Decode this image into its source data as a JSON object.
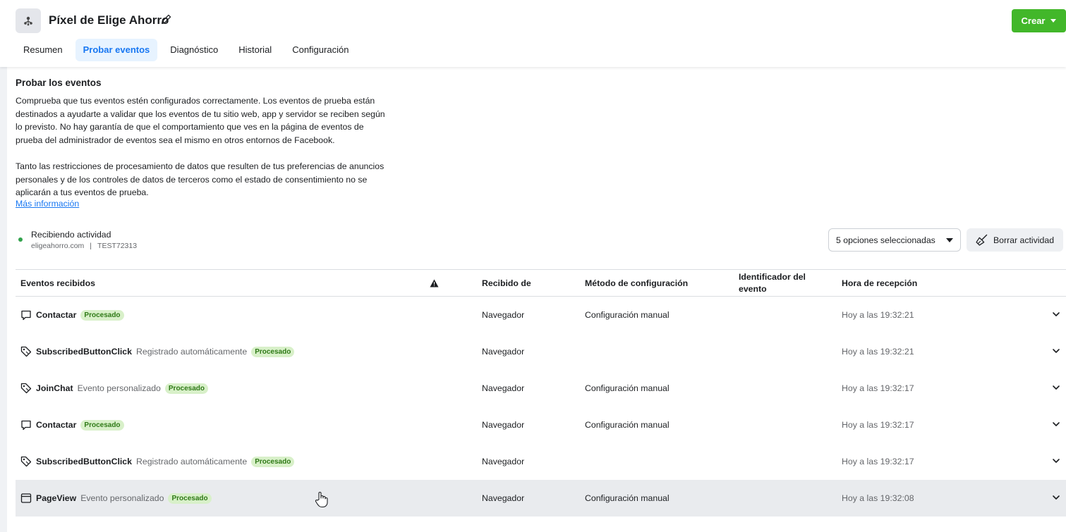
{
  "header": {
    "title": "Píxel de Elige Ahorro",
    "create_label": "Crear",
    "tabs": [
      {
        "label": "Resumen",
        "active": false
      },
      {
        "label": "Probar eventos",
        "active": true
      },
      {
        "label": "Diagnóstico",
        "active": false
      },
      {
        "label": "Historial",
        "active": false
      },
      {
        "label": "Configuración",
        "active": false
      }
    ]
  },
  "intro": {
    "title": "Probar los eventos",
    "paragraph1": "Comprueba que tus eventos estén configurados correctamente. Los eventos de prueba están destinados a ayudarte a validar que los eventos de tu sitio web, app y servidor se reciben según lo previsto. No hay garantía de que el comportamiento que ves en la página de eventos de prueba del administrador de eventos sea el mismo en otros entornos de Facebook.",
    "paragraph2": "Tanto las restricciones de procesamiento de datos que resulten de tus preferencias de anuncios personales y de los controles de datos de terceros como el estado de consentimiento no se aplicarán a tus eventos de prueba.",
    "link": "Más información"
  },
  "status": {
    "label": "Recibiendo actividad",
    "domain": "eligeahorro.com",
    "separator": "|",
    "test_code": "TEST72313",
    "dot_color": "#31a24c"
  },
  "controls": {
    "filter_label": "5 opciones seleccionadas",
    "clear_label": "Borrar actividad"
  },
  "table": {
    "headers": {
      "events": "Eventos recibidos",
      "received_from": "Recibido de",
      "method": "Método de configuración",
      "event_id_line1": "Identificador del",
      "event_id_line2": "evento",
      "time": "Hora de recepción"
    },
    "rows": [
      {
        "icon": "chat-icon",
        "name": "Contactar",
        "sub": "",
        "badge": "Procesado",
        "source": "Navegador",
        "method": "Configuración manual",
        "event_id": "",
        "time": "Hoy a las 19:32:21"
      },
      {
        "icon": "tag-icon",
        "name": "SubscribedButtonClick",
        "sub": "Registrado automáticamente",
        "badge": "Procesado",
        "source": "Navegador",
        "method": "",
        "event_id": "",
        "time": "Hoy a las 19:32:21"
      },
      {
        "icon": "tag-icon",
        "name": "JoinChat",
        "sub": "Evento personalizado",
        "badge": "Procesado",
        "source": "Navegador",
        "method": "Configuración manual",
        "event_id": "",
        "time": "Hoy a las 19:32:17"
      },
      {
        "icon": "chat-icon",
        "name": "Contactar",
        "sub": "",
        "badge": "Procesado",
        "source": "Navegador",
        "method": "Configuración manual",
        "event_id": "",
        "time": "Hoy a las 19:32:17"
      },
      {
        "icon": "tag-icon",
        "name": "SubscribedButtonClick",
        "sub": "Registrado automáticamente",
        "badge": "Procesado",
        "source": "Navegador",
        "method": "",
        "event_id": "",
        "time": "Hoy a las 19:32:17"
      },
      {
        "icon": "page-icon",
        "name": "PageView",
        "sub": "Evento personalizado",
        "badge": "Procesado",
        "source": "Navegador",
        "method": "Configuración manual",
        "event_id": "",
        "time": "Hoy a las 19:32:08"
      }
    ]
  }
}
